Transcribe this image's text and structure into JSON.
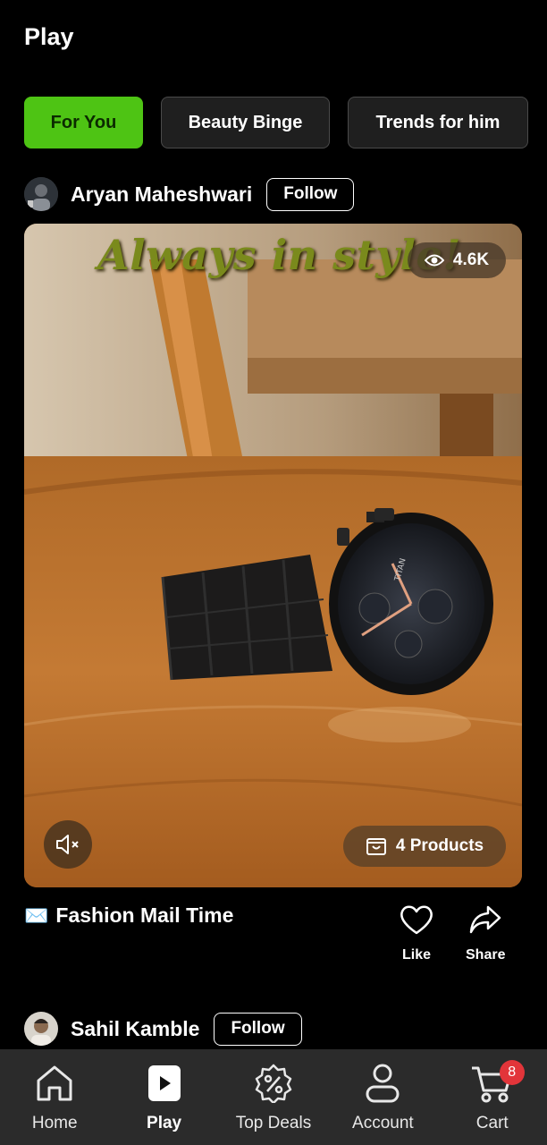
{
  "header": {
    "title": "Play"
  },
  "tabs": [
    {
      "label": "For You",
      "active": true
    },
    {
      "label": "Beauty Binge",
      "active": false
    },
    {
      "label": "Trends for him",
      "active": false
    }
  ],
  "posts": [
    {
      "creator": "Aryan Maheshwari",
      "follow_label": "Follow",
      "overlay_text": "Always in style!",
      "views": "4.6K",
      "products_label": "4 Products",
      "caption_emoji": "✉️",
      "caption": "Fashion Mail Time",
      "like_label": "Like",
      "share_label": "Share"
    },
    {
      "creator": "Sahil Kamble",
      "follow_label": "Follow"
    }
  ],
  "bottom_nav": [
    {
      "label": "Home",
      "icon": "home-icon"
    },
    {
      "label": "Play",
      "icon": "play-icon",
      "active": true
    },
    {
      "label": "Top Deals",
      "icon": "percent-badge-icon"
    },
    {
      "label": "Account",
      "icon": "user-icon"
    },
    {
      "label": "Cart",
      "icon": "cart-icon",
      "badge": "8"
    }
  ],
  "colors": {
    "accent": "#4ec414",
    "badge": "#e2353a",
    "nav_bg": "#2b2b2b"
  }
}
